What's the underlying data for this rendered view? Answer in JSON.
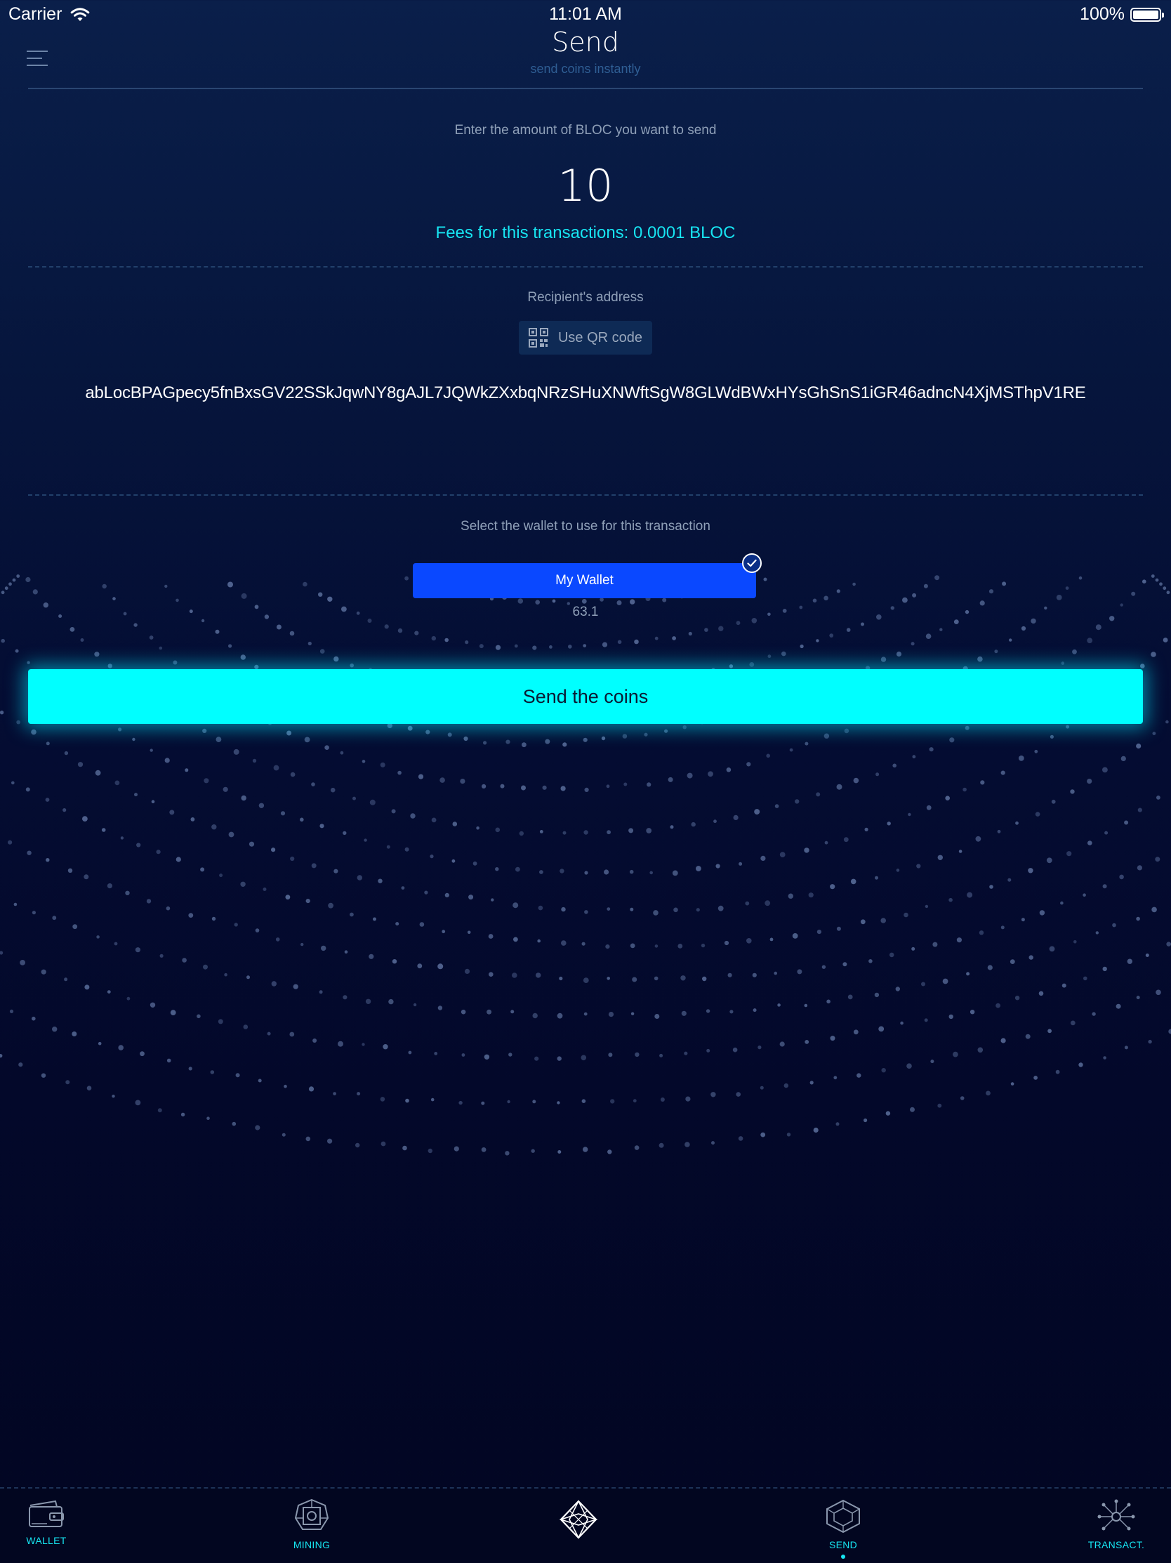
{
  "status_bar": {
    "carrier": "Carrier",
    "time": "11:01 AM",
    "battery": "100%",
    "battery_level": 1.0
  },
  "header": {
    "title": "Send",
    "subtitle": "send coins instantly",
    "menu_icon": "hamburger-menu-icon"
  },
  "amount": {
    "label": "Enter the amount of BLOC you want to send",
    "value": "10",
    "fees": "Fees for this transactions: 0.0001 BLOC"
  },
  "recipient": {
    "label": "Recipient's address",
    "qr_button_label": "Use QR code",
    "qr_icon": "qr-code-icon",
    "address": "abLocBPAGpecy5fnBxsGV22SSkJqwNY8gAJL7JQWkZXxbqNRzSHuXNWftSgW8GLWdBWxHYsGhSnS1iGR46adncN4XjMSThpV1RE"
  },
  "wallet_select": {
    "label": "Select the wallet to use for this transaction",
    "wallet_name": "My Wallet",
    "wallet_balance": "63.1",
    "selected": true
  },
  "send_button": {
    "label": "Send the coins"
  },
  "tabs": [
    {
      "label": "WALLET",
      "icon": "wallet-icon"
    },
    {
      "label": "MINING",
      "icon": "mining-chip-icon"
    },
    {
      "label": "",
      "icon": "bloc-logo-icon"
    },
    {
      "label": "SEND",
      "icon": "send-cube-icon",
      "active": true
    },
    {
      "label": "TRANSACT.",
      "icon": "transactions-network-icon"
    }
  ],
  "colors": {
    "accent_cyan": "#00ffff",
    "wallet_blue": "#0a48ff",
    "fees_text": "#17e5f2",
    "background_dark": "#020622"
  }
}
